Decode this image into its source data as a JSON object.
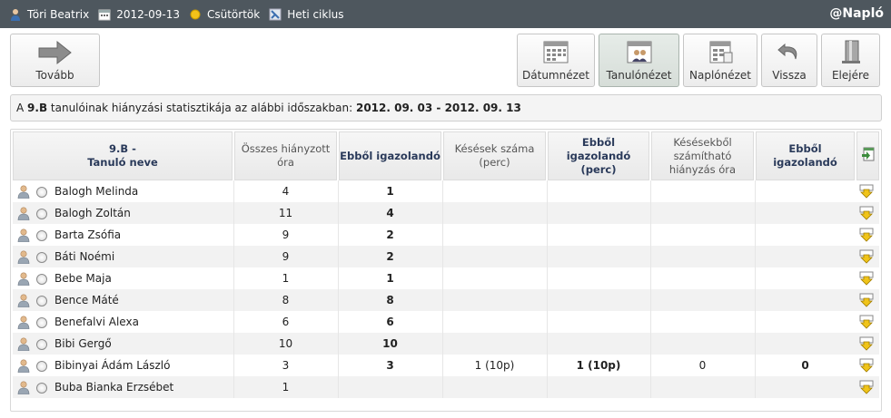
{
  "topbar": {
    "user": "Töri Beatrix",
    "date": "2012-09-13",
    "day": "Csütörtök",
    "cycle": "Heti ciklus",
    "brand": "@Napló"
  },
  "toolbar": {
    "next_label": "Tovább",
    "date_view_label": "Dátumnézet",
    "student_view_label": "Tanulónézet",
    "diary_view_label": "Naplónézet",
    "back_label": "Vissza",
    "first_label": "Elejére"
  },
  "info": {
    "prefix": "A ",
    "class": "9.B",
    "middle": " tanulóinak hiányzási statisztikája az alábbi időszakban: ",
    "period": "2012. 09. 03 - 2012. 09. 13"
  },
  "table": {
    "headers": {
      "name_line1": "9.B -",
      "name_line2": "Tanuló neve",
      "missed_total": "Összes hiányzott óra",
      "missed_excusable": "Ebből igazolandó",
      "late_count": "Késések száma (perc)",
      "late_excusable": "Ebből igazolandó (perc)",
      "late_hours": "Késésekből számítható hiányzás óra",
      "late_hours_excusable": "Ebből igazolandó"
    },
    "rows": [
      {
        "name": "Balogh Melinda",
        "total": "4",
        "exc": "1",
        "late": "",
        "late_exc": "",
        "late_hours": "",
        "late_hours_exc": ""
      },
      {
        "name": "Balogh Zoltán",
        "total": "11",
        "exc": "4",
        "late": "",
        "late_exc": "",
        "late_hours": "",
        "late_hours_exc": ""
      },
      {
        "name": "Barta Zsófia",
        "total": "9",
        "exc": "2",
        "late": "",
        "late_exc": "",
        "late_hours": "",
        "late_hours_exc": ""
      },
      {
        "name": "Báti Noémi",
        "total": "9",
        "exc": "2",
        "late": "",
        "late_exc": "",
        "late_hours": "",
        "late_hours_exc": ""
      },
      {
        "name": "Bebe Maja",
        "total": "1",
        "exc": "1",
        "late": "",
        "late_exc": "",
        "late_hours": "",
        "late_hours_exc": ""
      },
      {
        "name": "Bence Máté",
        "total": "8",
        "exc": "8",
        "late": "",
        "late_exc": "",
        "late_hours": "",
        "late_hours_exc": ""
      },
      {
        "name": "Benefalvi Alexa",
        "total": "6",
        "exc": "6",
        "late": "",
        "late_exc": "",
        "late_hours": "",
        "late_hours_exc": ""
      },
      {
        "name": "Bibi Gergő",
        "total": "10",
        "exc": "10",
        "late": "",
        "late_exc": "",
        "late_hours": "",
        "late_hours_exc": ""
      },
      {
        "name": "Bibinyai Ádám László",
        "total": "3",
        "exc": "3",
        "late": "1 (10p)",
        "late_exc": "1 (10p)",
        "late_hours": "0",
        "late_hours_exc": "0"
      },
      {
        "name": "Buba Bianka Erzsébet",
        "total": "1",
        "exc": "",
        "late": "",
        "late_exc": "",
        "late_hours": "",
        "late_hours_exc": ""
      }
    ]
  },
  "colors": {
    "topbar_bg": "#4e575e",
    "header_bold_text": "#2a3a5a",
    "odd_row_bg": "#f2f2f2"
  }
}
